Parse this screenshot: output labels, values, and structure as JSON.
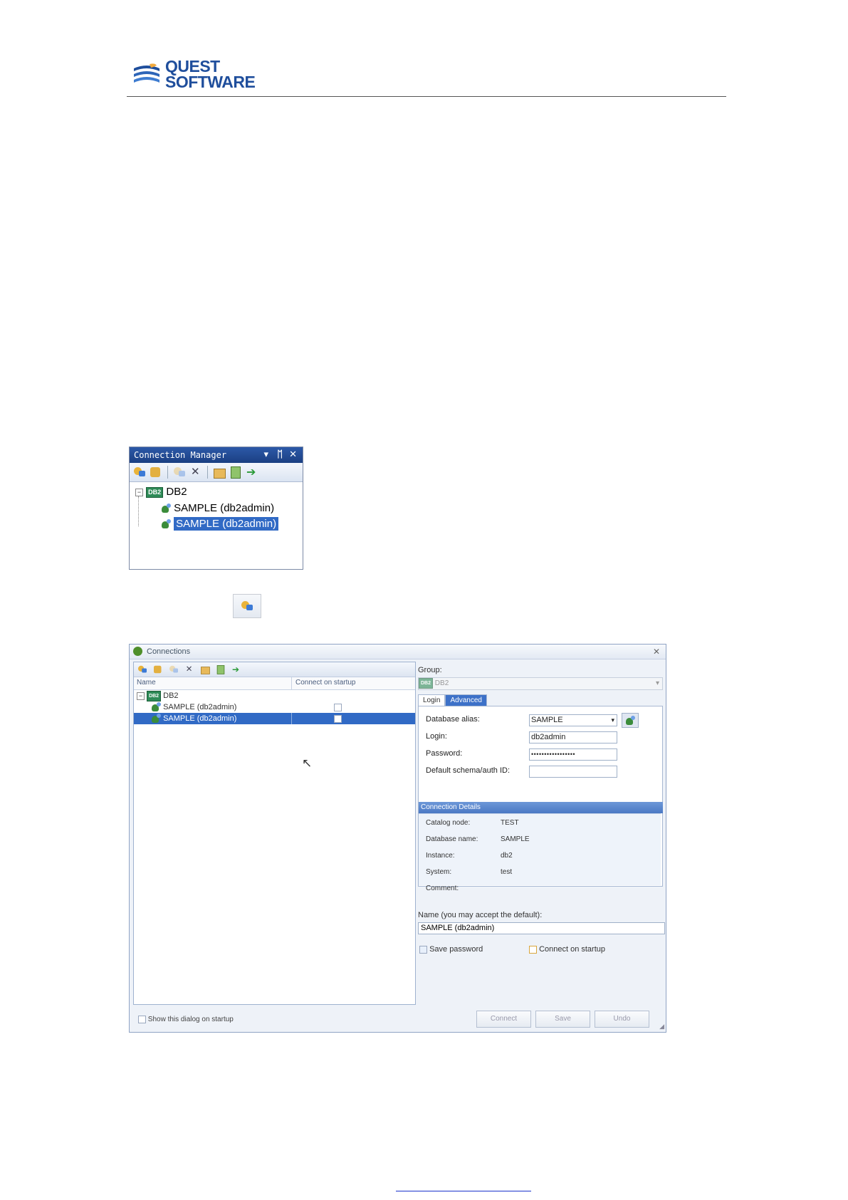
{
  "brand": {
    "line1": "QUEST",
    "line2": "SOFTWARE"
  },
  "connection_manager": {
    "title": "Connection Manager",
    "controls": {
      "menu": "▾",
      "pin": "ᛖ",
      "close": "✕"
    },
    "toolbar_icons": [
      "new-connection-icon",
      "new-group-icon",
      "disabled-edit-icon",
      "delete-icon",
      "properties-icon",
      "refresh-icon",
      "connect-icon"
    ],
    "tree": {
      "root": "DB2",
      "items": [
        "SAMPLE (db2admin)",
        "SAMPLE (db2admin)"
      ]
    }
  },
  "connections_dialog": {
    "title": "Connections",
    "grid": {
      "headers": [
        "Name",
        "Connect on startup"
      ],
      "root": "DB2",
      "rows": [
        {
          "name": "SAMPLE (db2admin)",
          "selected": false
        },
        {
          "name": "SAMPLE (db2admin)",
          "selected": true
        }
      ]
    },
    "show_on_startup": "Show this dialog on startup",
    "group_label": "Group:",
    "group_value": "DB2",
    "tabs": [
      "Login",
      "Advanced"
    ],
    "fields": {
      "database_alias_label": "Database alias:",
      "database_alias_value": "SAMPLE",
      "login_label": "Login:",
      "login_value": "db2admin",
      "password_label": "Password:",
      "password_value": "•••••••••••••••••",
      "schema_label": "Default schema/auth ID:",
      "schema_value": ""
    },
    "details": {
      "header": "Connection Details",
      "rows": [
        {
          "label": "Catalog node:",
          "value": "TEST"
        },
        {
          "label": "Database name:",
          "value": "SAMPLE"
        },
        {
          "label": "Instance:",
          "value": "db2"
        },
        {
          "label": "System:",
          "value": "test"
        },
        {
          "label": "Comment:",
          "value": ""
        }
      ]
    },
    "name_label": "Name (you may accept the default):",
    "name_value": "SAMPLE (db2admin)",
    "save_password": "Save password",
    "connect_on_startup": "Connect on startup",
    "buttons": {
      "connect": "Connect",
      "save": "Save",
      "undo": "Undo"
    }
  }
}
